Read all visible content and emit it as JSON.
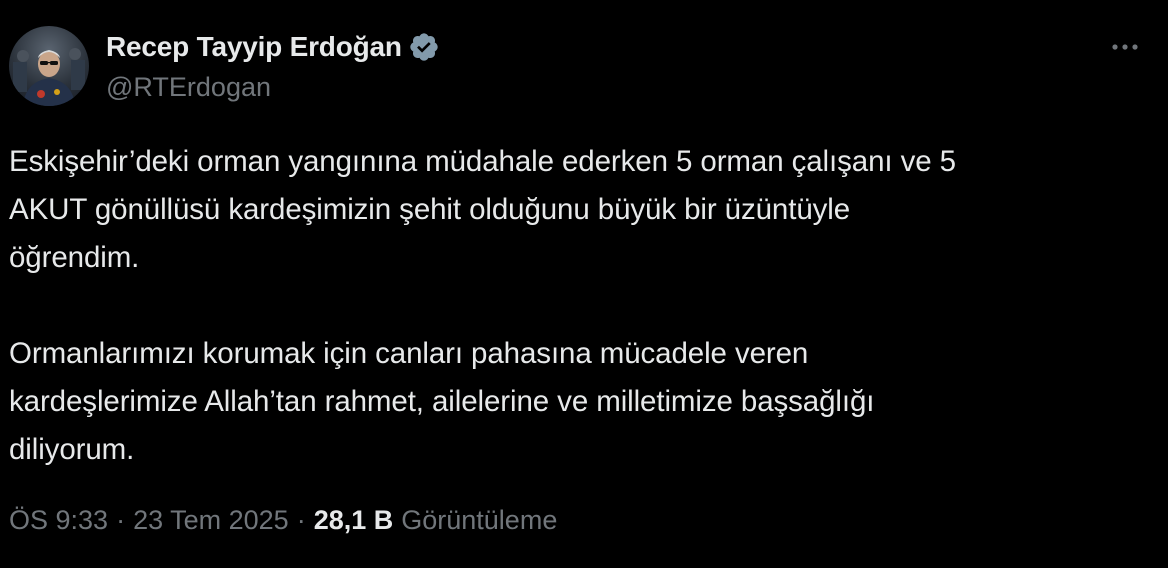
{
  "author": {
    "display_name": "Recep Tayyip Erdoğan",
    "handle": "@RTErdogan",
    "verified_icon": "verified-badge-icon",
    "verified_color": "#829aab"
  },
  "tweet": {
    "paragraphs": [
      "Eskişehir’deki orman yangınına müdahale ederken 5 orman çalışanı ve 5\nAKUT gönüllüsü kardeşimizin şehit olduğunu büyük bir üzüntüyle\nöğrendim.",
      "Ormanlarımızı korumak için canları pahasına mücadele veren\nkardeşlerimize Allah’tan rahmet, ailelerine ve milletimize başsağlığı\ndiliyorum."
    ]
  },
  "meta": {
    "time": "ÖS 9:33",
    "separator": "·",
    "date": "23 Tem 2025",
    "views_count": "28,1 B",
    "views_label": "Görüntüleme"
  },
  "icons": {
    "more": "more-horizontal-icon",
    "avatar": "avatar"
  },
  "colors": {
    "background": "#000000",
    "text_primary": "#e7e9ea",
    "text_secondary": "#71767b"
  }
}
